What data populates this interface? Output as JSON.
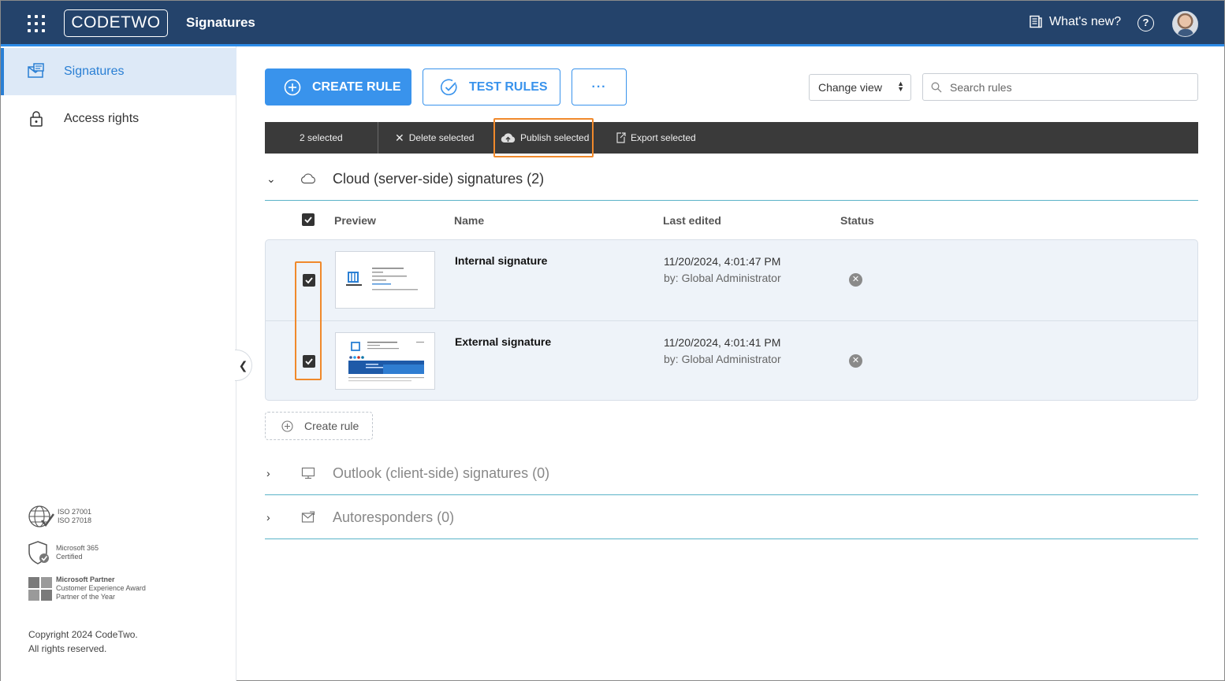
{
  "header": {
    "logo_text": "CODETWO",
    "app_title": "Signatures",
    "whats_new": "What's new?",
    "help": "?"
  },
  "sidebar": {
    "items": [
      {
        "label": "Signatures",
        "icon": "signatures-icon",
        "active": true
      },
      {
        "label": "Access rights",
        "icon": "lock-icon",
        "active": false
      }
    ],
    "certs": [
      {
        "line1": "ISO 27001",
        "line2": "ISO 27018",
        "icon": "globe-check-icon"
      },
      {
        "line1": "Microsoft 365",
        "line2": "Certified",
        "icon": "shield-check-icon"
      },
      {
        "line1": "Microsoft Partner",
        "line2": "Customer Experience Award",
        "line3": "Partner of the Year",
        "icon": "microsoft-logo-icon"
      }
    ],
    "copyright_line1": "Copyright 2024 CodeTwo.",
    "copyright_line2": "All rights reserved."
  },
  "toolbar": {
    "create_rule": "CREATE RULE",
    "test_rules": "TEST RULES",
    "more": "···",
    "change_view": "Change view",
    "search_placeholder": "Search rules"
  },
  "actionbar": {
    "selected": "2 selected",
    "delete": "Delete selected",
    "publish": "Publish selected",
    "export": "Export selected"
  },
  "sections": {
    "cloud": {
      "title": "Cloud (server-side) signatures (2)",
      "expanded": true
    },
    "outlook": {
      "title": "Outlook (client-side) signatures (0)",
      "expanded": false
    },
    "autoresponders": {
      "title": "Autoresponders (0)",
      "expanded": false
    }
  },
  "table": {
    "columns": {
      "preview": "Preview",
      "name": "Name",
      "last_edited": "Last edited",
      "status": "Status"
    },
    "rows": [
      {
        "name": "Internal signature",
        "date": "11/20/2024, 4:01:47 PM",
        "by": "by: Global Administrator",
        "checked": true,
        "status": "not-published"
      },
      {
        "name": "External signature",
        "date": "11/20/2024, 4:01:41 PM",
        "by": "by: Global Administrator",
        "checked": true,
        "status": "not-published"
      }
    ]
  },
  "create_rule_link": "Create rule",
  "colors": {
    "header_bg": "#24436b",
    "accent": "#3993ec",
    "highlight": "#f0892b",
    "actionbar_bg": "#3a3a3a"
  }
}
